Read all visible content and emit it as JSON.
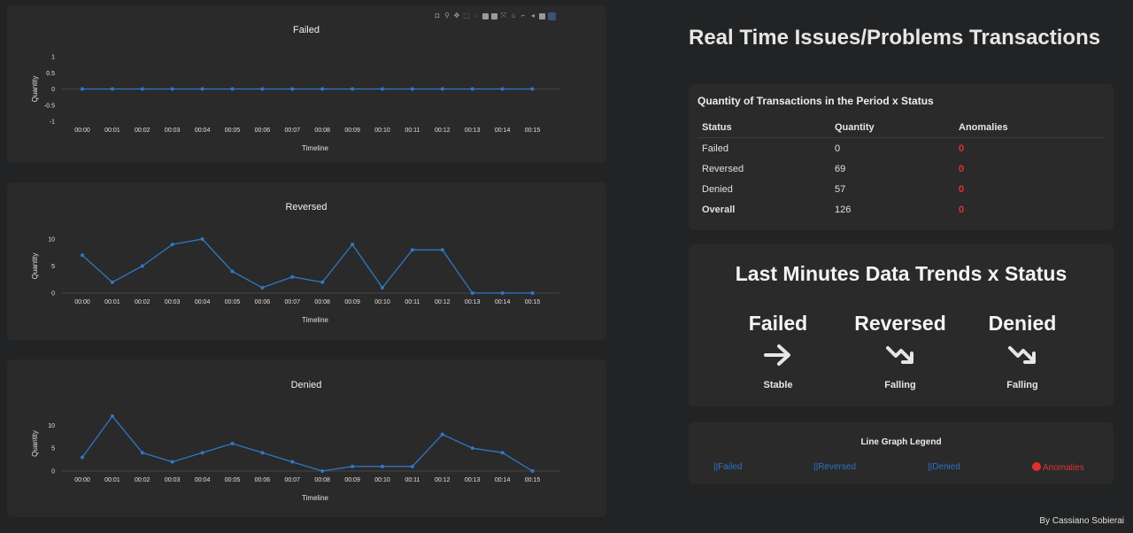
{
  "modebar_icons": [
    "camera-icon",
    "zoom-icon",
    "pan-icon",
    "box-select-icon",
    "lasso-icon",
    "zoom-in-icon",
    "zoom-out-icon",
    "autoscale-icon",
    "reset-axes-icon",
    "spike-lines-icon",
    "hover-closest-icon",
    "hover-compare-icon",
    "plotly-logo-icon"
  ],
  "chart_data": [
    {
      "type": "line",
      "title": "Failed",
      "xlabel": "Timeline",
      "ylabel": "Quantity",
      "categories": [
        "00:00",
        "00:01",
        "00:02",
        "00:03",
        "00:04",
        "00:05",
        "00:06",
        "00:07",
        "00:08",
        "00:09",
        "00:10",
        "00:11",
        "00:12",
        "00:13",
        "00:14",
        "00:15"
      ],
      "values": [
        0,
        0,
        0,
        0,
        0,
        0,
        0,
        0,
        0,
        0,
        0,
        0,
        0,
        0,
        0,
        0
      ],
      "yticks": [
        1,
        0.5,
        0,
        -0.5,
        -1
      ],
      "ylim": [
        -1,
        1
      ],
      "color": "#2e78c7"
    },
    {
      "type": "line",
      "title": "Reversed",
      "xlabel": "Timeline",
      "ylabel": "Quantity",
      "categories": [
        "00:00",
        "00:01",
        "00:02",
        "00:03",
        "00:04",
        "00:05",
        "00:06",
        "00:07",
        "00:08",
        "00:09",
        "00:10",
        "00:11",
        "00:12",
        "00:13",
        "00:14",
        "00:15"
      ],
      "values": [
        7,
        2,
        5,
        9,
        10,
        4,
        1,
        3,
        2,
        9,
        1,
        8,
        8,
        0,
        0,
        0
      ],
      "yticks": [
        10,
        5,
        0
      ],
      "ylim": [
        0,
        10
      ],
      "color": "#2e78c7"
    },
    {
      "type": "line",
      "title": "Denied",
      "xlabel": "Timeline",
      "ylabel": "Quantity",
      "categories": [
        "00:00",
        "00:01",
        "00:02",
        "00:03",
        "00:04",
        "00:05",
        "00:06",
        "00:07",
        "00:08",
        "00:09",
        "00:10",
        "00:11",
        "00:12",
        "00:13",
        "00:14",
        "00:15"
      ],
      "values": [
        3,
        12,
        4,
        2,
        4,
        6,
        4,
        2,
        0,
        1,
        1,
        1,
        8,
        5,
        4,
        0
      ],
      "yticks": [
        10,
        5,
        0
      ],
      "ylim": [
        0,
        12
      ],
      "color": "#2e78c7"
    }
  ],
  "page_title": "Real Time Issues/Problems Transactions",
  "table": {
    "title": "Quantity of Transactions in the Period x Status",
    "headers": [
      "Status",
      "Quantity",
      "Anomalies"
    ],
    "rows": [
      {
        "status": "Failed",
        "quantity": "0",
        "anomalies": "0"
      },
      {
        "status": "Reversed",
        "quantity": "69",
        "anomalies": "0"
      },
      {
        "status": "Denied",
        "quantity": "57",
        "anomalies": "0"
      },
      {
        "status": "Overall",
        "quantity": "126",
        "anomalies": "0"
      }
    ]
  },
  "trends": {
    "title": "Last Minutes Data Trends x Status",
    "items": [
      {
        "name": "Failed",
        "status": "Stable",
        "icon": "arrow-right-icon"
      },
      {
        "name": "Reversed",
        "status": "Falling",
        "icon": "trending-down-icon"
      },
      {
        "name": "Denied",
        "status": "Falling",
        "icon": "trending-down-icon"
      }
    ]
  },
  "legend": {
    "title": "Line Graph Legend",
    "items": [
      {
        "label": "Failed",
        "marker": "||"
      },
      {
        "label": "Reversed",
        "marker": "||"
      },
      {
        "label": "Denied",
        "marker": "||"
      },
      {
        "label": "Anomalies",
        "marker": "dot"
      }
    ],
    "line_color": "#2b72c4",
    "anomaly_color": "#e03131"
  },
  "author": "By Cassiano Sobierai"
}
